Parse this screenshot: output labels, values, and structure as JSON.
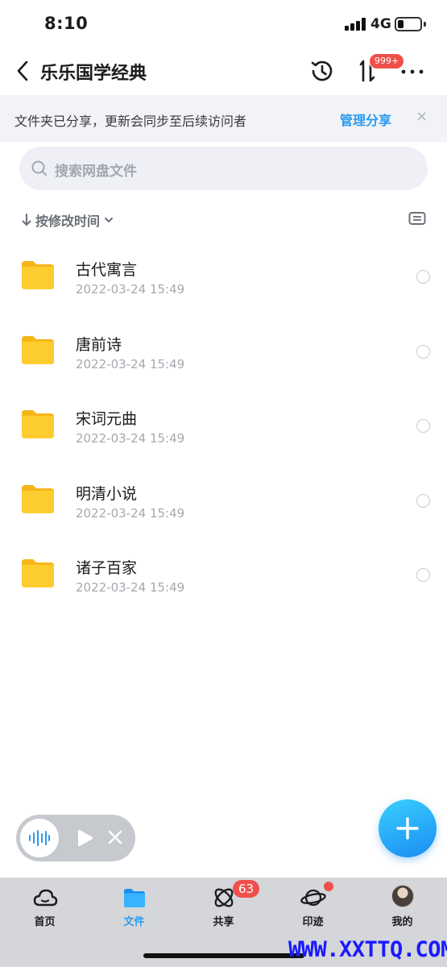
{
  "status_bar": {
    "time": "8:10",
    "network": "4G"
  },
  "nav": {
    "title": "乐乐国学经典",
    "transfer_badge": "999+"
  },
  "share_banner": {
    "text": "文件夹已分享，更新会同步至后续访问者",
    "manage_label": "管理分享",
    "close_glyph": "×"
  },
  "search": {
    "placeholder": "搜索网盘文件"
  },
  "sort": {
    "label": "按修改时间"
  },
  "files": [
    {
      "name": "古代寓言",
      "date": "2022-03-24 15:49"
    },
    {
      "name": "唐前诗",
      "date": "2022-03-24 15:49"
    },
    {
      "name": "宋词元曲",
      "date": "2022-03-24 15:49"
    },
    {
      "name": "明清小说",
      "date": "2022-03-24 15:49"
    },
    {
      "name": "诸子百家",
      "date": "2022-03-24 15:49"
    }
  ],
  "tabs": [
    {
      "label": "首页",
      "icon": "cloud-icon"
    },
    {
      "label": "文件",
      "icon": "folder-icon",
      "active": true
    },
    {
      "label": "共享",
      "icon": "atom-icon",
      "badge": "63"
    },
    {
      "label": "印迹",
      "icon": "planet-icon"
    },
    {
      "label": "我的",
      "icon": "avatar"
    }
  ],
  "watermark": "WWW.XXTTQ.COM",
  "colors": {
    "accent": "#2a9af0",
    "badge": "#f0504b",
    "folder": "#fbc31f"
  }
}
